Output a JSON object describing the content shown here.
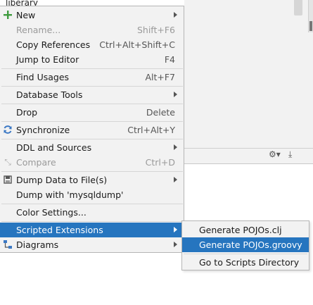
{
  "background": {
    "top_label": "liberary"
  },
  "context_menu": {
    "items": [
      {
        "label": "New",
        "shortcut": "",
        "submenu": true,
        "icon": "plus-icon",
        "disabled": false
      },
      {
        "label": "Rename...",
        "shortcut": "Shift+F6",
        "submenu": false,
        "icon": "",
        "disabled": true
      },
      {
        "label": "Copy References",
        "shortcut": "Ctrl+Alt+Shift+C",
        "submenu": false,
        "icon": "",
        "disabled": false
      },
      {
        "label": "Jump to Editor",
        "shortcut": "F4",
        "submenu": false,
        "icon": "",
        "disabled": false
      },
      {
        "label": "Find Usages",
        "shortcut": "Alt+F7",
        "submenu": false,
        "icon": "",
        "disabled": false
      },
      {
        "label": "Database Tools",
        "shortcut": "",
        "submenu": true,
        "icon": "",
        "disabled": false
      },
      {
        "label": "Drop",
        "shortcut": "Delete",
        "submenu": false,
        "icon": "",
        "disabled": false
      },
      {
        "label": "Synchronize",
        "shortcut": "Ctrl+Alt+Y",
        "submenu": false,
        "icon": "sync-icon",
        "disabled": false
      },
      {
        "label": "DDL and Sources",
        "shortcut": "",
        "submenu": true,
        "icon": "",
        "disabled": false
      },
      {
        "label": "Compare",
        "shortcut": "Ctrl+D",
        "submenu": false,
        "icon": "compare-icon",
        "disabled": true
      },
      {
        "label": "Dump Data to File(s)",
        "shortcut": "",
        "submenu": true,
        "icon": "dump-icon",
        "disabled": false
      },
      {
        "label": "Dump with 'mysqldump'",
        "shortcut": "",
        "submenu": false,
        "icon": "",
        "disabled": false
      },
      {
        "label": "Color Settings...",
        "shortcut": "",
        "submenu": false,
        "icon": "",
        "disabled": false
      },
      {
        "label": "Scripted Extensions",
        "shortcut": "",
        "submenu": true,
        "icon": "",
        "disabled": false,
        "selected": true
      },
      {
        "label": "Diagrams",
        "shortcut": "",
        "submenu": true,
        "icon": "diagram-icon",
        "disabled": false
      }
    ]
  },
  "submenu": {
    "items": [
      {
        "label": "Generate POJOs.clj"
      },
      {
        "label": "Generate POJOs.groovy",
        "selected": true
      },
      {
        "label": "Go to Scripts Directory"
      }
    ]
  },
  "colors": {
    "selection": "#2675bf",
    "menu_bg": "#f2f2f2",
    "plus_icon": "#3f9b3f",
    "sync_icon": "#3b78c4"
  }
}
